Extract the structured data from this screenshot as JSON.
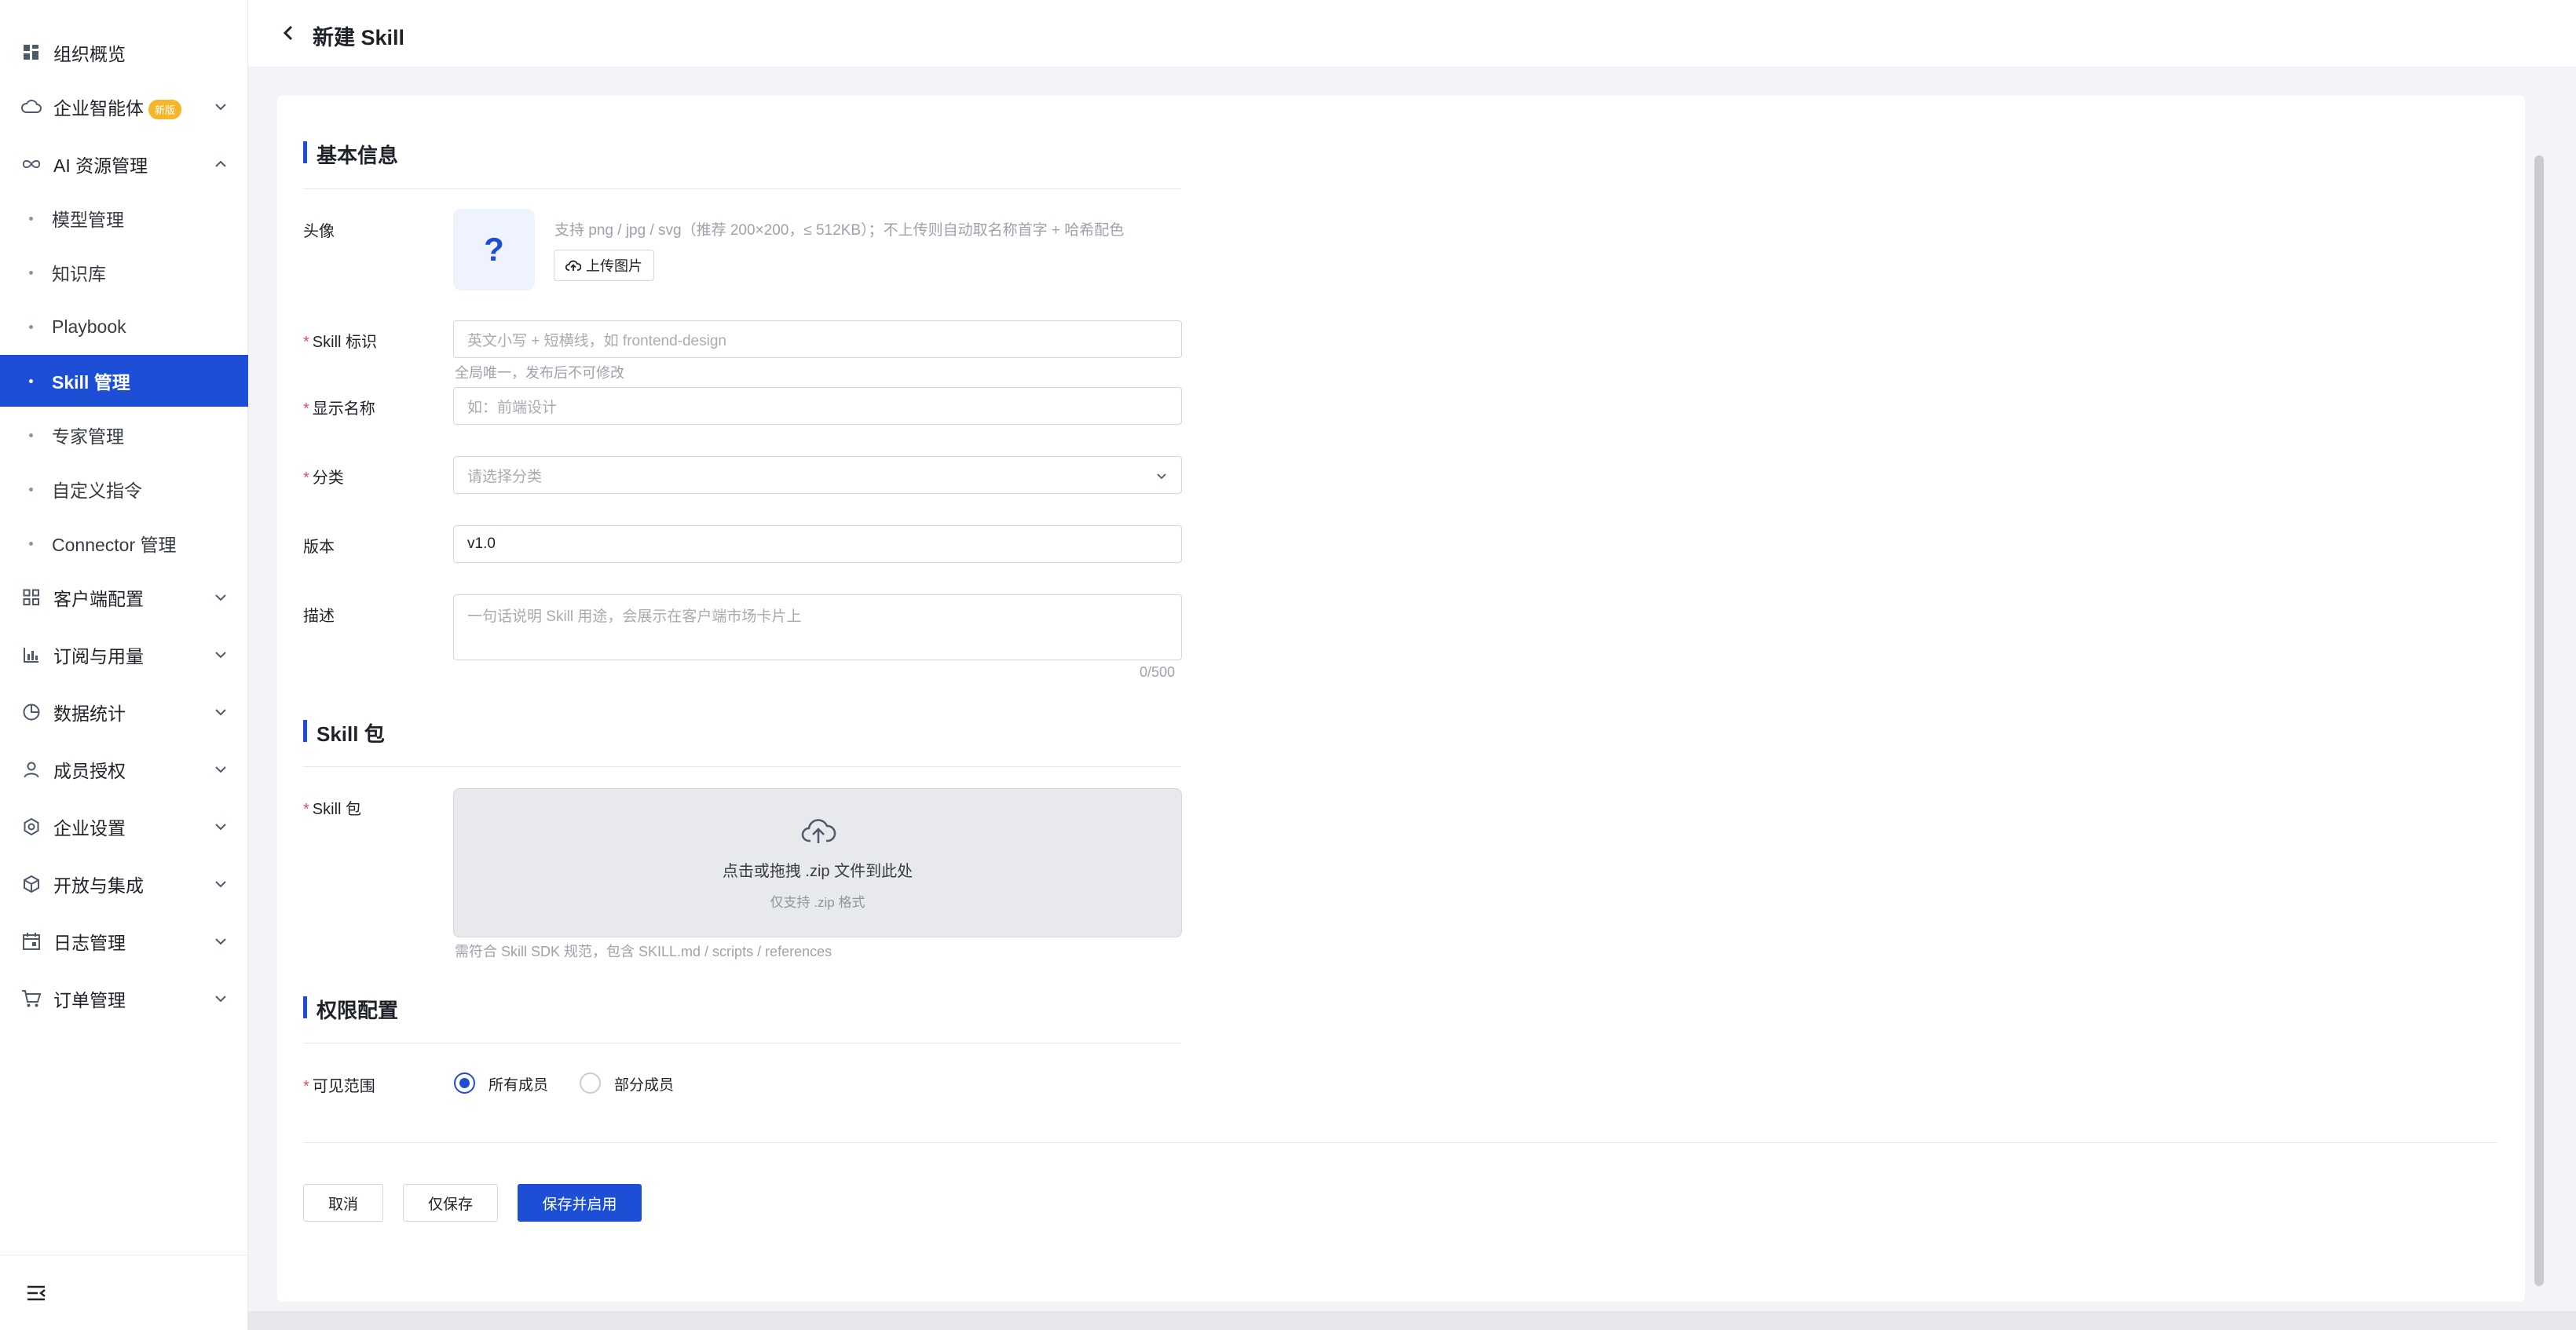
{
  "sidebar": {
    "items": [
      {
        "label": "组织概览",
        "icon": "dashboard-icon"
      },
      {
        "label": "企业智能体",
        "icon": "cloud-icon",
        "badge": "新版"
      },
      {
        "label": "AI 资源管理",
        "icon": "infinity-icon"
      },
      {
        "label": "模型管理"
      },
      {
        "label": "知识库"
      },
      {
        "label": "Playbook"
      },
      {
        "label": "Skill 管理"
      },
      {
        "label": "专家管理"
      },
      {
        "label": "自定义指令"
      },
      {
        "label": "Connector 管理"
      },
      {
        "label": "客户端配置",
        "icon": "grid-icon"
      },
      {
        "label": "订阅与用量",
        "icon": "bar-chart-icon"
      },
      {
        "label": "数据统计",
        "icon": "pie-chart-icon"
      },
      {
        "label": "成员授权",
        "icon": "user-icon"
      },
      {
        "label": "企业设置",
        "icon": "settings-icon"
      },
      {
        "label": "开放与集成",
        "icon": "cube-icon"
      },
      {
        "label": "日志管理",
        "icon": "calendar-icon"
      },
      {
        "label": "订单管理",
        "icon": "cart-icon"
      }
    ],
    "active": "Skill 管理"
  },
  "header": {
    "title": "新建 Skill"
  },
  "sections": {
    "basic": "基本信息",
    "package": "Skill 包",
    "permission": "权限配置"
  },
  "form": {
    "avatar": {
      "label": "头像",
      "placeholder": "?",
      "hint": "支持 png / jpg / svg（推荐 200×200，≤ 512KB）；不上传则自动取名称首字 + 哈希配色",
      "upload_label": "上传图片"
    },
    "skill_id": {
      "label": "Skill 标识",
      "placeholder": "英文小写 + 短横线，如 frontend-design",
      "hint": "全局唯一，发布后不可修改"
    },
    "display_name": {
      "label": "显示名称",
      "placeholder": "如：前端设计"
    },
    "category": {
      "label": "分类",
      "placeholder": "请选择分类"
    },
    "version": {
      "label": "版本",
      "value": "v1.0"
    },
    "description": {
      "label": "描述",
      "placeholder": "一句话说明 Skill 用途，会展示在客户端市场卡片上",
      "counter": "0/500"
    },
    "package": {
      "label": "Skill 包",
      "drop_main": "点击或拖拽 .zip 文件到此处",
      "drop_sub": "仅支持 .zip 格式",
      "hint": "需符合 Skill SDK 规范，包含 SKILL.md / scripts / references"
    },
    "visibility": {
      "label": "可见范围",
      "options": [
        "所有成员",
        "部分成员"
      ],
      "selected": "所有成员"
    }
  },
  "actions": {
    "cancel": "取消",
    "save_only": "仅保存",
    "save_enable": "保存并启用"
  },
  "required_mark": "*",
  "colors": {
    "accent": "#1d4fd6",
    "badge": "#f6b52a",
    "required": "#e34d59"
  }
}
